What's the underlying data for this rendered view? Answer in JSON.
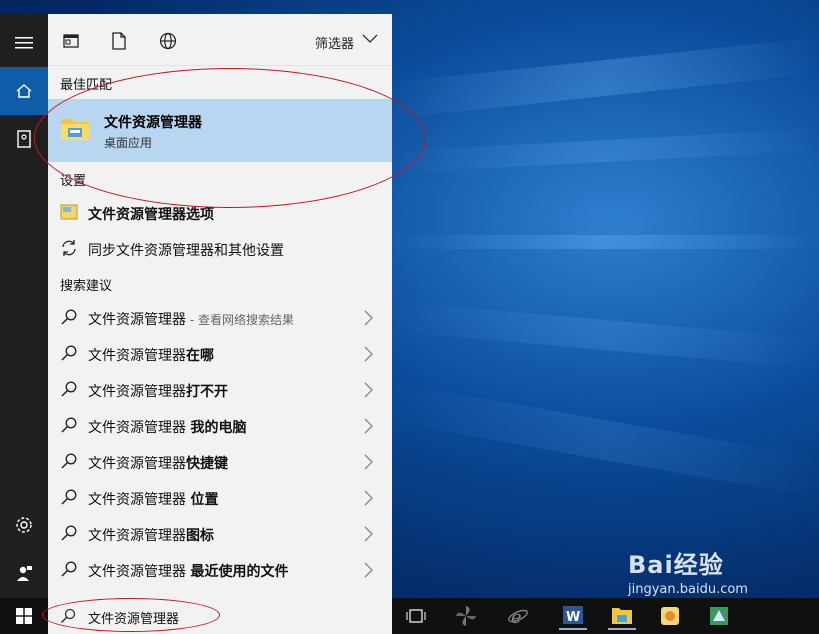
{
  "filter_bar": {
    "filter_label": "筛选器"
  },
  "sections": {
    "best_match": "最佳匹配",
    "settings": "设置",
    "suggestions": "搜索建议"
  },
  "best_match": {
    "title": "文件资源管理器",
    "subtitle": "桌面应用"
  },
  "settings_items": [
    {
      "label": "文件资源管理器选项"
    },
    {
      "label": "同步文件资源管理器和其他设置"
    }
  ],
  "suggestions": [
    {
      "prefix": "文件资源管理器",
      "bold": "",
      "hint": " - 查看网络搜索结果"
    },
    {
      "prefix": "文件资源管理器",
      "bold": "在哪",
      "hint": ""
    },
    {
      "prefix": "文件资源管理器",
      "bold": "打不开",
      "hint": ""
    },
    {
      "prefix": "文件资源管理器 ",
      "bold": "我的电脑",
      "hint": ""
    },
    {
      "prefix": "文件资源管理器",
      "bold": "快捷键",
      "hint": ""
    },
    {
      "prefix": "文件资源管理器 ",
      "bold": "位置",
      "hint": ""
    },
    {
      "prefix": "文件资源管理器",
      "bold": "图标",
      "hint": ""
    },
    {
      "prefix": "文件资源管理器 ",
      "bold": "最近使用的文件",
      "hint": ""
    }
  ],
  "search": {
    "value": "文件资源管理器"
  },
  "watermark": {
    "brand": "Bai经验",
    "url": "jingyan.baidu.com"
  },
  "colors": {
    "accent": "#0f5ca8",
    "selected": "#b8d6f0",
    "annotation": "#c8141e"
  }
}
